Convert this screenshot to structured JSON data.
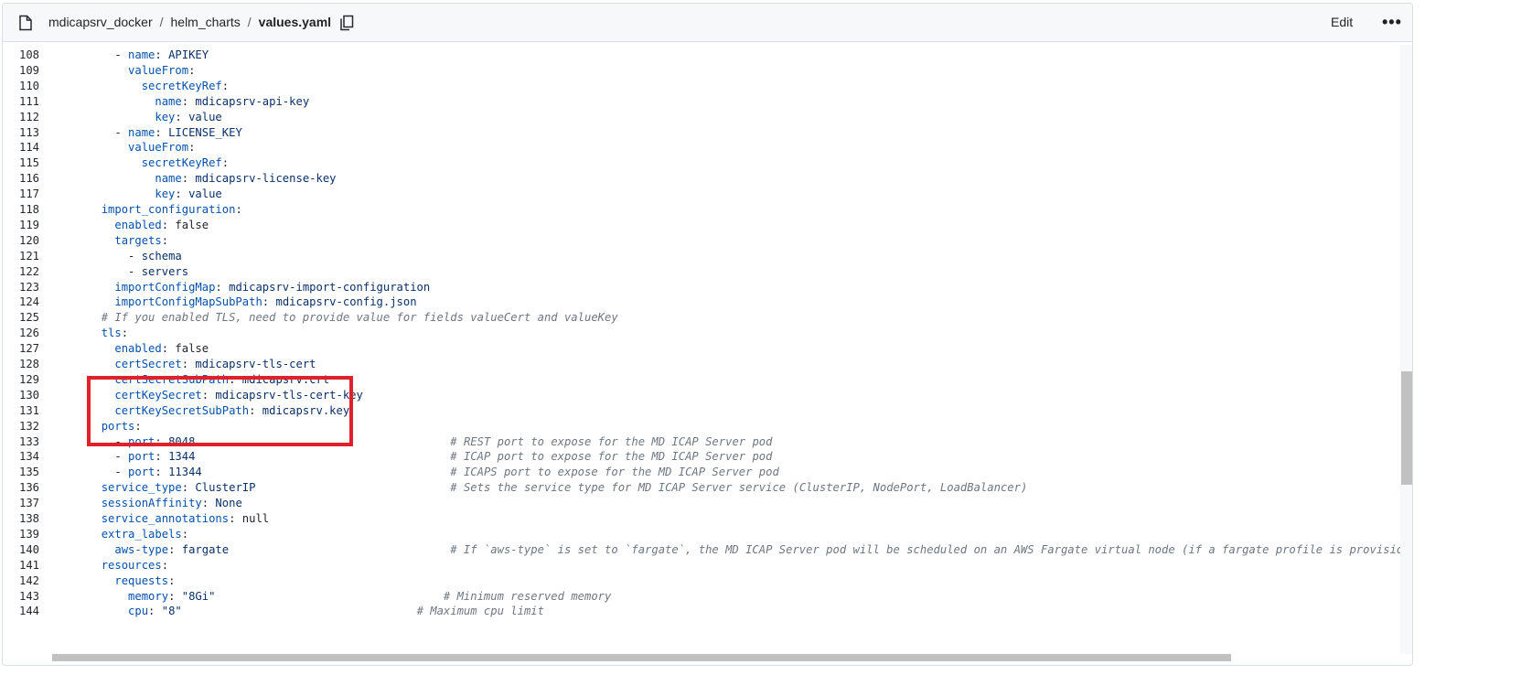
{
  "header": {
    "breadcrumb": [
      "mdicapsrv_docker",
      "helm_charts",
      "values.yaml"
    ],
    "separator": "/",
    "edit_label": "Edit",
    "more_label": "•••",
    "icons": {
      "file": "file-icon",
      "copy": "copy-icon",
      "more": "kebab-horizontal-icon"
    }
  },
  "colors": {
    "highlight_box": "#e0202a",
    "key": "#0550ae",
    "value": "#0a3069",
    "comment": "#6e7781"
  },
  "code": {
    "lines": [
      {
        "n": "108",
        "text": "    - name: APIKEY"
      },
      {
        "n": "109",
        "text": "      valueFrom:"
      },
      {
        "n": "110",
        "text": "        secretKeyRef:"
      },
      {
        "n": "111",
        "text": "          name: mdicapsrv-api-key"
      },
      {
        "n": "112",
        "text": "          key: value"
      },
      {
        "n": "113",
        "text": "    - name: LICENSE_KEY"
      },
      {
        "n": "114",
        "text": "      valueFrom:"
      },
      {
        "n": "115",
        "text": "        secretKeyRef:"
      },
      {
        "n": "116",
        "text": "          name: mdicapsrv-license-key"
      },
      {
        "n": "117",
        "text": "          key: value"
      },
      {
        "n": "118",
        "text": "  import_configuration:"
      },
      {
        "n": "119",
        "text": "    enabled: false"
      },
      {
        "n": "120",
        "text": "    targets:"
      },
      {
        "n": "121",
        "text": "      - schema"
      },
      {
        "n": "122",
        "text": "      - servers"
      },
      {
        "n": "123",
        "text": "    importConfigMap: mdicapsrv-import-configuration"
      },
      {
        "n": "124",
        "text": "    importConfigMapSubPath: mdicapsrv-config.json"
      },
      {
        "n": "125",
        "text": "  # If you enabled TLS, need to provide value for fields valueCert and valueKey"
      },
      {
        "n": "126",
        "text": "  tls:"
      },
      {
        "n": "127",
        "text": "    enabled: false"
      },
      {
        "n": "128",
        "text": "    certSecret: mdicapsrv-tls-cert"
      },
      {
        "n": "129",
        "text": "    certSecretSubPath: mdicapsrv.crt"
      },
      {
        "n": "130",
        "text": "    certKeySecret: mdicapsrv-tls-cert-key"
      },
      {
        "n": "131",
        "text": "    certKeySecretSubPath: mdicapsrv.key"
      },
      {
        "n": "132",
        "text": "  ports:"
      },
      {
        "n": "133",
        "text": "    - port: 8048                                      # REST port to expose for the MD ICAP Server pod"
      },
      {
        "n": "134",
        "text": "    - port: 1344                                      # ICAP port to expose for the MD ICAP Server pod"
      },
      {
        "n": "135",
        "text": "    - port: 11344                                     # ICAPS port to expose for the MD ICAP Server pod"
      },
      {
        "n": "136",
        "text": "  service_type: ClusterIP                             # Sets the service type for MD ICAP Server service (ClusterIP, NodePort, LoadBalancer)"
      },
      {
        "n": "137",
        "text": "  sessionAffinity: None"
      },
      {
        "n": "138",
        "text": "  service_annotations: null"
      },
      {
        "n": "139",
        "text": "  extra_labels:"
      },
      {
        "n": "140",
        "text": "    aws-type: fargate                                 # If `aws-type` is set to `fargate`, the MD ICAP Server pod will be scheduled on an AWS Fargate virtual node (if a fargate profile is provisioned a"
      },
      {
        "n": "141",
        "text": "  resources:"
      },
      {
        "n": "142",
        "text": "    requests:"
      },
      {
        "n": "143",
        "text": "      memory: \"8Gi\"                                  # Minimum reserved memory"
      },
      {
        "n": "144",
        "text": "      cpu: \"8\"                                   # Maximum cpu limit"
      }
    ]
  }
}
